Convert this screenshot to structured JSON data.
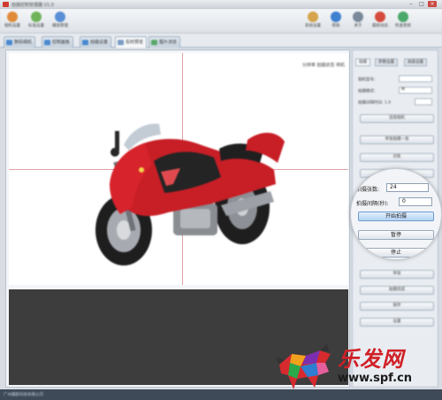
{
  "window": {
    "title": "拍摄控制管理器 V1.0"
  },
  "toolbar": {
    "left": [
      {
        "label": "相机设置",
        "color": "#e08a3a"
      },
      {
        "label": "标准设置",
        "color": "#6fb35a"
      },
      {
        "label": "播放管理",
        "color": "#5a8fd6"
      }
    ],
    "right": [
      {
        "label": "系统设置",
        "color": "#d6a34a"
      },
      {
        "label": "帮助",
        "color": "#3e7fd0"
      },
      {
        "label": "关于",
        "color": "#7a8a9a"
      },
      {
        "label": "最新动态",
        "color": "#d64a3e"
      },
      {
        "label": "检查更新",
        "color": "#4aa86a"
      }
    ]
  },
  "tabs": [
    "数码相机",
    "控制面板",
    "拍摄设置",
    "实时预览",
    "图片浏览"
  ],
  "viewer": {
    "info": "分辨率 拍摄状态 待机"
  },
  "panel": {
    "tabs": [
      "拍摄",
      "参数设置",
      "高级设置"
    ],
    "labels": [
      "相机型号:",
      "拍摄模式:",
      "拍摄间隔时间: 1.0"
    ],
    "fields": [
      "",
      "M",
      ""
    ],
    "buttons": [
      "连接相机",
      "单张拍摄一张",
      "对焦",
      "自动曝光",
      "单张",
      "拍摄完成",
      "保存",
      "设置"
    ]
  },
  "loupe": {
    "count_label": "拍摄张数:",
    "count_value": "24",
    "interval_label": "拍摄间隔(秒):",
    "interval_value": "0",
    "start_button": "开始拍摄",
    "pause_button": "暂停",
    "stop_button": "停止"
  },
  "status": {
    "text": "广州摄影科技有限公司"
  },
  "watermark": {
    "name": "乐发网",
    "url": "www.spf.cn"
  }
}
